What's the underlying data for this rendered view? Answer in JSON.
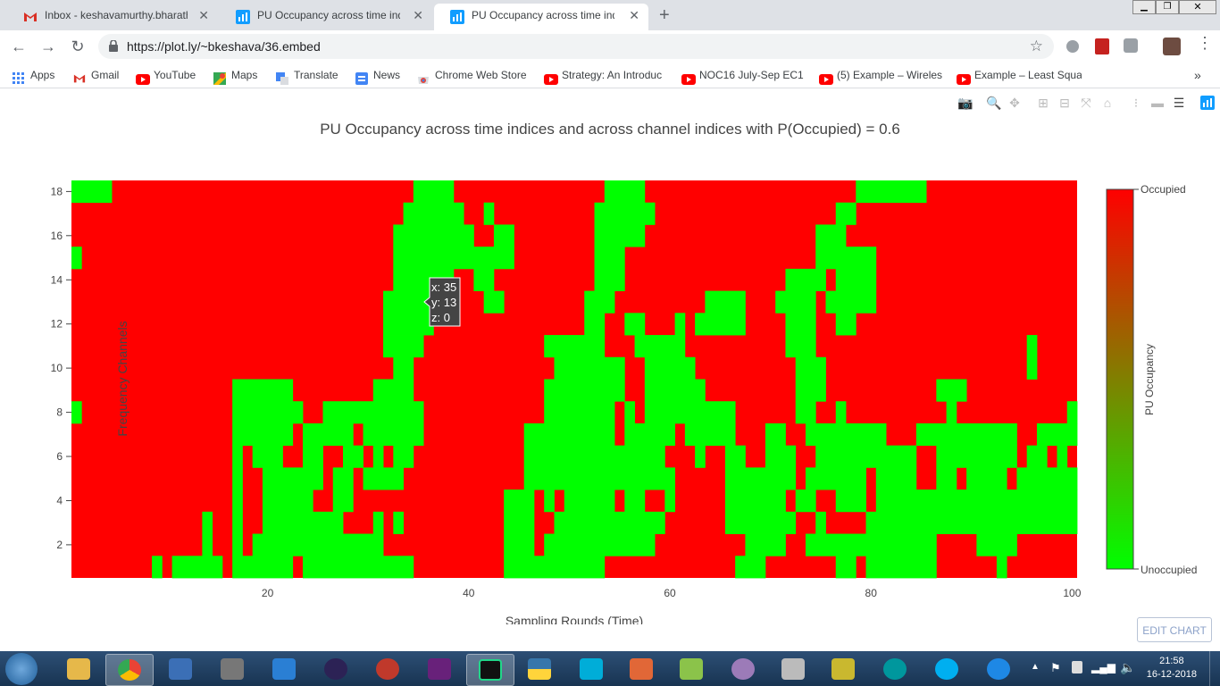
{
  "tabs": [
    {
      "title": "Inbox - keshavamurthy.bharath@",
      "icon": "gmail-icon",
      "active": false
    },
    {
      "title": "PU Occupancy across time indice",
      "icon": "plotly-icon",
      "active": false
    },
    {
      "title": "PU Occupancy across time indice",
      "icon": "plotly-icon",
      "active": true
    }
  ],
  "toolbar": {
    "url": "https://plot.ly/~bkeshava/36.embed"
  },
  "bookmarks": [
    {
      "label": "Apps",
      "icon": "apps-icon"
    },
    {
      "label": "Gmail",
      "icon": "gmail-icon"
    },
    {
      "label": "YouTube",
      "icon": "youtube-icon"
    },
    {
      "label": "Maps",
      "icon": "maps-icon"
    },
    {
      "label": "Translate",
      "icon": "translate-icon"
    },
    {
      "label": "News",
      "icon": "news-icon"
    },
    {
      "label": "Chrome Web Store",
      "icon": "webstore-icon"
    },
    {
      "label": "Strategy: An Introduc",
      "icon": "youtube-icon"
    },
    {
      "label": "NOC16 July-Sep EC1",
      "icon": "youtube-icon"
    },
    {
      "label": "(5) Example – Wireles",
      "icon": "youtube-icon"
    },
    {
      "label": "Example – Least Squa",
      "icon": "youtube-icon"
    }
  ],
  "colors": {
    "occupied": "#ff0000",
    "unoccupied": "#00ff00",
    "mid": "#808000"
  },
  "chart_data": {
    "type": "heatmap",
    "title": "PU Occupancy across time indices and across channel indices with P(Occupied) = 0.6",
    "xlabel": "Sampling Rounds (Time)",
    "ylabel": "Frequency Channels",
    "x_range": [
      1,
      100
    ],
    "y_range": [
      1,
      18
    ],
    "x_ticks": [
      20,
      40,
      60,
      80,
      100
    ],
    "y_ticks": [
      2,
      4,
      6,
      8,
      10,
      12,
      14,
      16,
      18
    ],
    "z_values": "1 = Occupied (red), 0 = Unoccupied (green)",
    "colorbar": {
      "title": "PU Occupancy",
      "top_label": "Occupied",
      "bottom_label": "Unoccupied"
    },
    "hover": {
      "x": "x: 35",
      "y": "y: 13",
      "z": "z: 0"
    },
    "green_intervals": {
      "1": [
        [
          9,
          9
        ],
        [
          11,
          15
        ],
        [
          17,
          22
        ],
        [
          24,
          34
        ],
        [
          44,
          53
        ],
        [
          67,
          69
        ],
        [
          77,
          78
        ],
        [
          80,
          86
        ],
        [
          93,
          93
        ]
      ],
      "2": [
        [
          14,
          14
        ],
        [
          17,
          17
        ],
        [
          19,
          31
        ],
        [
          44,
          46
        ],
        [
          48,
          58
        ],
        [
          68,
          71
        ],
        [
          74,
          86
        ],
        [
          91,
          94
        ]
      ],
      "3": [
        [
          14,
          14
        ],
        [
          17,
          17
        ],
        [
          20,
          27
        ],
        [
          31,
          31
        ],
        [
          33,
          33
        ],
        [
          44,
          46
        ],
        [
          49,
          59
        ],
        [
          66,
          72
        ],
        [
          75,
          75
        ],
        [
          80,
          100
        ]
      ],
      "4": [
        [
          17,
          17
        ],
        [
          20,
          24
        ],
        [
          27,
          28
        ],
        [
          44,
          46
        ],
        [
          48,
          48
        ],
        [
          50,
          54
        ],
        [
          56,
          57
        ],
        [
          60,
          60
        ],
        [
          66,
          71
        ],
        [
          73,
          74
        ],
        [
          77,
          79
        ],
        [
          81,
          100
        ]
      ],
      "5": [
        [
          17,
          17
        ],
        [
          20,
          25
        ],
        [
          27,
          28
        ],
        [
          30,
          33
        ],
        [
          46,
          60
        ],
        [
          66,
          72
        ],
        [
          74,
          79
        ],
        [
          81,
          84
        ],
        [
          87,
          88
        ],
        [
          90,
          93
        ],
        [
          95,
          100
        ]
      ],
      "6": [
        [
          17,
          17
        ],
        [
          19,
          21
        ],
        [
          24,
          25
        ],
        [
          28,
          29
        ],
        [
          31,
          31
        ],
        [
          33,
          34
        ],
        [
          46,
          59
        ],
        [
          63,
          63
        ],
        [
          66,
          67
        ],
        [
          70,
          72
        ],
        [
          75,
          84
        ],
        [
          87,
          94
        ],
        [
          96,
          97
        ],
        [
          99,
          99
        ]
      ],
      "7": [
        [
          17,
          22
        ],
        [
          24,
          28
        ],
        [
          30,
          35
        ],
        [
          46,
          54
        ],
        [
          56,
          60
        ],
        [
          62,
          66
        ],
        [
          70,
          71
        ],
        [
          74,
          81
        ],
        [
          85,
          94
        ],
        [
          97,
          100
        ]
      ],
      "8": [
        [
          1,
          1
        ],
        [
          17,
          23
        ],
        [
          26,
          35
        ],
        [
          48,
          54
        ],
        [
          56,
          56
        ],
        [
          58,
          66
        ],
        [
          73,
          74
        ],
        [
          77,
          77
        ],
        [
          88,
          88
        ],
        [
          100,
          100
        ]
      ],
      "9": [
        [
          17,
          22
        ],
        [
          31,
          34
        ],
        [
          48,
          55
        ],
        [
          58,
          63
        ],
        [
          73,
          75
        ],
        [
          87,
          89
        ]
      ],
      "10": [
        [
          33,
          34
        ],
        [
          49,
          55
        ],
        [
          58,
          62
        ],
        [
          73,
          75
        ],
        [
          96,
          96
        ]
      ],
      "11": [
        [
          32,
          35
        ],
        [
          48,
          53
        ],
        [
          57,
          61
        ],
        [
          72,
          74
        ],
        [
          96,
          96
        ]
      ],
      "12": [
        [
          32,
          36
        ],
        [
          52,
          53
        ],
        [
          56,
          57
        ],
        [
          61,
          61
        ],
        [
          63,
          67
        ],
        [
          72,
          74
        ],
        [
          77,
          78
        ]
      ],
      "13": [
        [
          32,
          36
        ],
        [
          42,
          43
        ],
        [
          52,
          54
        ],
        [
          64,
          67
        ],
        [
          71,
          74
        ],
        [
          76,
          80
        ]
      ],
      "14": [
        [
          33,
          38
        ],
        [
          41,
          42
        ],
        [
          53,
          55
        ],
        [
          72,
          75
        ],
        [
          77,
          80
        ]
      ],
      "15": [
        [
          1,
          1
        ],
        [
          33,
          44
        ],
        [
          53,
          55
        ],
        [
          75,
          80
        ]
      ],
      "16": [
        [
          33,
          40
        ],
        [
          43,
          44
        ],
        [
          53,
          57
        ],
        [
          75,
          77
        ]
      ],
      "17": [
        [
          34,
          39
        ],
        [
          42,
          42
        ],
        [
          53,
          58
        ],
        [
          77,
          78
        ]
      ],
      "18": [
        [
          1,
          4
        ],
        [
          35,
          38
        ],
        [
          54,
          57
        ],
        [
          79,
          85
        ]
      ]
    }
  },
  "edit_chart_label": "EDIT CHART",
  "taskbar": {
    "time": "21:58",
    "date": "16-12-2018"
  }
}
